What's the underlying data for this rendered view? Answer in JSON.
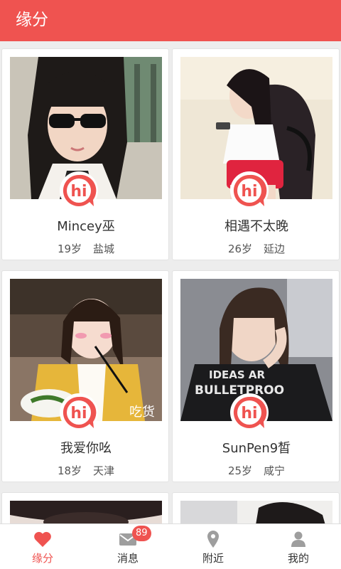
{
  "app": {
    "title": "缘分"
  },
  "cards": [
    {
      "name": "Mincey巫",
      "age": "19岁",
      "city": "盐城",
      "hi": "hi"
    },
    {
      "name": "相遇不太晚",
      "age": "26岁",
      "city": "延边",
      "hi": "hi"
    },
    {
      "name": "我爱你吆",
      "age": "18岁",
      "city": "天津",
      "hi": "hi"
    },
    {
      "name": "SunPen9皙",
      "age": "25岁",
      "city": "咸宁",
      "hi": "hi"
    }
  ],
  "photo_overlays": {
    "snack_text": "吃货",
    "shirt_text_1": "IDEAS AR",
    "shirt_text_2": "BULLETPROO"
  },
  "tabs": [
    {
      "label": "缘分",
      "icon": "heart-icon",
      "active": true
    },
    {
      "label": "消息",
      "icon": "mail-icon",
      "badge": "89"
    },
    {
      "label": "附近",
      "icon": "location-pin-icon"
    },
    {
      "label": "我的",
      "icon": "person-icon"
    }
  ],
  "colors": {
    "accent": "#ef5350",
    "inactive_icon": "#9e9e9e",
    "background": "#ededed"
  }
}
